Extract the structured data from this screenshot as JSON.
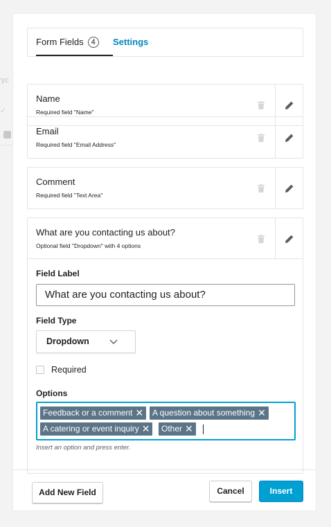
{
  "background": {
    "fragment_text": "ryc"
  },
  "tabs": {
    "fields_label": "Form Fields",
    "fields_count": "4",
    "settings_label": "Settings"
  },
  "fields": [
    {
      "title": "Name",
      "subtitle": "Required field \"Name\""
    },
    {
      "title": "Email",
      "subtitle": "Required field \"Email Address\""
    },
    {
      "title": "Comment",
      "subtitle": "Required field \"Text Area\""
    },
    {
      "title": "What are you contacting us about?",
      "subtitle": "Optional field \"Dropdown\" with 4 options"
    }
  ],
  "editor": {
    "field_label_heading": "Field Label",
    "field_label_value": "What are you contacting us about?",
    "field_type_heading": "Field Type",
    "field_type_value": "Dropdown",
    "required_label": "Required",
    "required_checked": false,
    "options_heading": "Options",
    "options": [
      "Feedback or a comment",
      "A question about something",
      "A catering or event inquiry",
      "Other"
    ],
    "options_hint": "Insert an option and press enter."
  },
  "footer": {
    "add_label": "Add New Field",
    "cancel_label": "Cancel",
    "insert_label": "Insert"
  },
  "colors": {
    "accent": "#00a0d2",
    "link": "#0087be",
    "token": "#5b7487"
  }
}
